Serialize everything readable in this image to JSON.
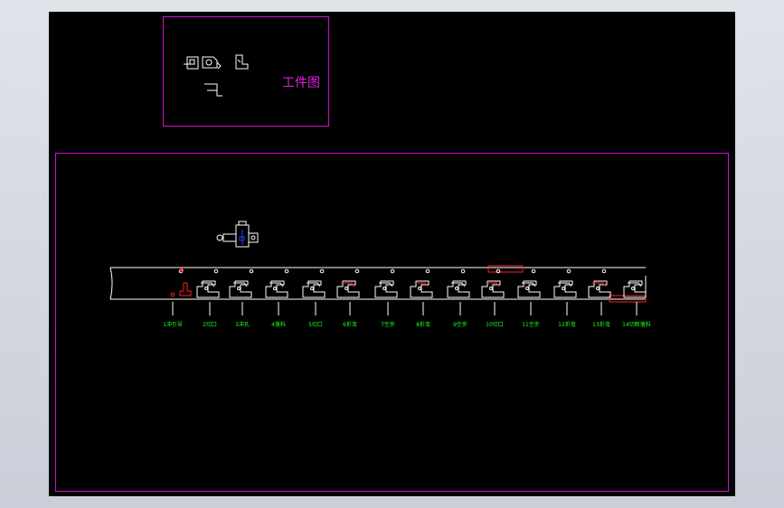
{
  "workpiece_label": "工件图",
  "stations": [
    "1冲引导",
    "2切口",
    "3冲孔",
    "4落料",
    "5切口",
    "6折弯",
    "7空步",
    "8折弯",
    "9空步",
    "10切口",
    "11空步",
    "12折弯",
    "13折弯",
    "14切断落料"
  ],
  "colors": {
    "frame": "#d010d0",
    "strip": "#ffffff",
    "cut": "#ff2020",
    "label": "#20ff20",
    "marker": "#2040ff"
  }
}
